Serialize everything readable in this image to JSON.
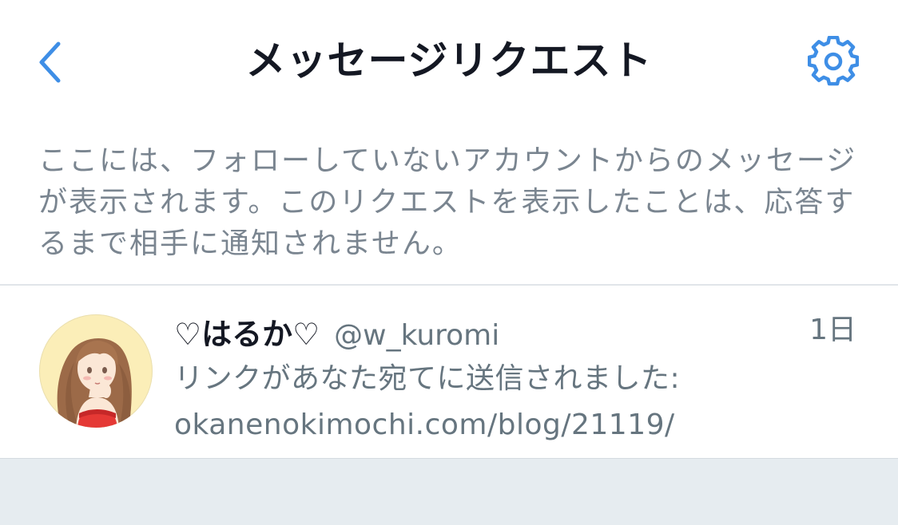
{
  "header": {
    "title": "メッセージリクエスト",
    "back_icon": "chevron-left-icon",
    "settings_icon": "gear-icon"
  },
  "info": {
    "text": "ここには、フォローしていないアカウントからのメッセージが表示されます。このリクエストを表示したことは、応答するまで相手に通知されません。"
  },
  "requests": [
    {
      "display_name": "♡はるか♡",
      "handle": "@w_kuromi",
      "time": "1日",
      "preview_line1": "リンクがあなた宛てに送信されました:",
      "preview_line2": "okanenokimochi.com/blog/21119/"
    }
  ],
  "colors": {
    "accent": "#1da1f2",
    "text_primary": "#141823",
    "text_secondary": "#66757f",
    "divider": "#e1e5e9",
    "footer_bg": "#e6ecf0"
  }
}
